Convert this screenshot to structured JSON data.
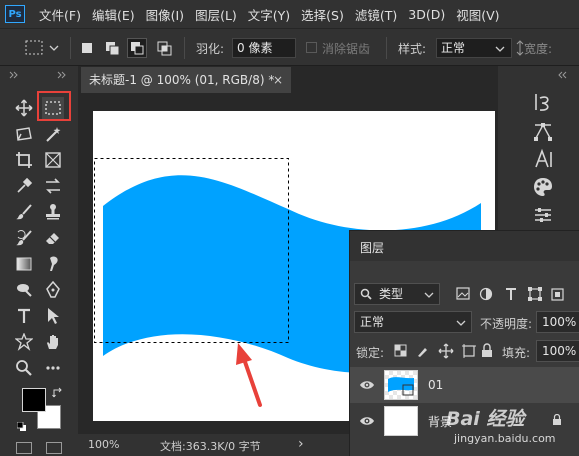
{
  "app": {
    "logo": "Ps"
  },
  "menu": [
    "文件(F)",
    "编辑(E)",
    "图像(I)",
    "图层(L)",
    "文字(Y)",
    "选择(S)",
    "滤镜(T)",
    "3D(D)",
    "视图(V)"
  ],
  "options_bar": {
    "feather_label": "羽化:",
    "feather_value": "0 像素",
    "antialias_label": "消除锯齿",
    "style_label": "样式:",
    "style_value": "正常",
    "width_label": "宽度:"
  },
  "document": {
    "tab_title": "未标题-1 @ 100% (01, RGB/8) *",
    "close_glyph": "×",
    "zoom": "100%",
    "doc_info": "文档:363.3K/0 字节",
    "status_arrow": "›"
  },
  "colors": {
    "shape_fill": "#00a2ff",
    "arrow": "#e8413a",
    "highlight_box": "#e8413a"
  },
  "layers_panel": {
    "tab_label": "图层",
    "filter_kind": "类型",
    "blend_mode": "正常",
    "opacity_label": "不透明度:",
    "opacity_value": "100%",
    "lock_label": "锁定:",
    "fill_label": "填充:",
    "fill_value": "100%",
    "layers": [
      {
        "name": "01"
      },
      {
        "name": "背景"
      }
    ]
  },
  "watermark": {
    "text_cn": "Bai 经验",
    "url": "jingyan.baidu.com"
  }
}
